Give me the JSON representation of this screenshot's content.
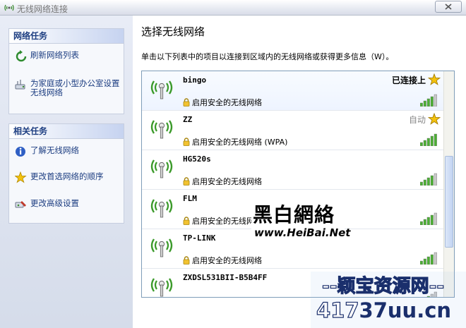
{
  "window": {
    "title": "无线网络连接"
  },
  "left_pane": {
    "network_tasks": {
      "header": "网络任务",
      "items": [
        {
          "label": "刷新网络列表",
          "icon": "refresh-icon"
        },
        {
          "label": "为家庭或小型办公室设置无线网络",
          "icon": "setup-network-icon"
        }
      ]
    },
    "related_tasks": {
      "header": "相关任务",
      "items": [
        {
          "label": "了解无线网络",
          "icon": "info-icon"
        },
        {
          "label": "更改首选网络的顺序",
          "icon": "star-icon"
        },
        {
          "label": "更改高级设置",
          "icon": "settings-icon"
        }
      ]
    }
  },
  "main": {
    "heading": "选择无线网络",
    "instruction": "单击以下列表中的项目以连接到区域内的无线网络或获得更多信息（W）。",
    "networks": [
      {
        "ssid": "bingo",
        "security": "启用安全的无线网络",
        "status": "已连接上",
        "signal": 0.8,
        "preferred": true
      },
      {
        "ssid": "ZZ",
        "security": "启用安全的无线网络 (WPA)",
        "status": "自动",
        "signal": 1.0,
        "preferred": true
      },
      {
        "ssid": "HG520s",
        "security": "启用安全的无线网络",
        "status": "",
        "signal": 0.8,
        "preferred": false
      },
      {
        "ssid": "FLM",
        "security": "启用安全的无线网络",
        "status": "",
        "signal": 0.8,
        "preferred": false
      },
      {
        "ssid": "TP-LINK",
        "security": "启用安全的无线网络",
        "status": "",
        "signal": 0.8,
        "preferred": false
      },
      {
        "ssid": "ZXDSL531BII-B5B4FF",
        "security": "",
        "status": "",
        "signal": 0.6,
        "preferred": false
      }
    ]
  },
  "watermarks": {
    "heibai_cn": "黑白網絡",
    "heibai_url": "www.HeiBai.Net",
    "site_line1": "--颖宝资源网--",
    "site_line2_a": "417",
    "site_line2_b": "37uu.cn"
  },
  "colors": {
    "link": "#1c3d81",
    "signal_green": "#4caf34",
    "signal_empty": "#c8c8c8",
    "star": "#f4c20d"
  }
}
